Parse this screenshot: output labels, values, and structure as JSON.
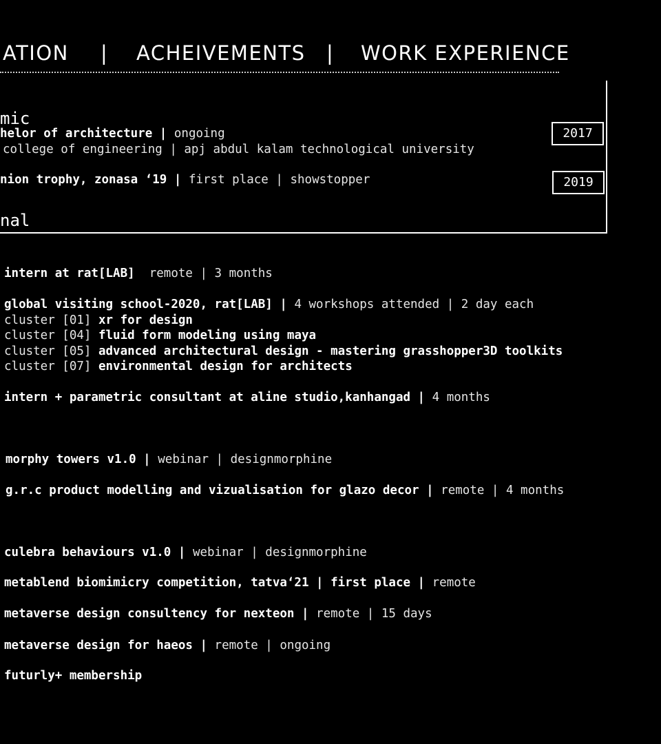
{
  "nav": {
    "education": "ATION",
    "sep1": "|",
    "achievements": "ACHEIVEMENTS",
    "sep2": "|",
    "work_experience": "WORK EXPERIENCE"
  },
  "panel": {
    "heading_academic": "mic",
    "degree_bold": "helor of architecture |",
    "degree_light": "ongoing",
    "college": "college of engineering | apj abdul kalam technological university",
    "year_1": "2017",
    "trophy_bold": "nion trophy, zonasa ‘19 |",
    "trophy_light": "first place | showstopper",
    "year_2": "2019",
    "heading_personal": "nal"
  },
  "entries": [
    {
      "bold": "intern at rat[LAB]",
      "light": "  remote | 3 months"
    },
    {
      "bold": "global visiting school-2020, rat[LAB] |",
      "light": " 4 workshops attended | 2 day each"
    },
    {
      "bold": "",
      "light": "cluster [01] ",
      "bold2": "xr for design"
    },
    {
      "bold": "",
      "light": "cluster [04] ",
      "bold2": "fluid form modeling using maya"
    },
    {
      "bold": "",
      "light": "cluster [05] ",
      "bold2": "advanced architectural design - mastering grasshopper3D toolkits"
    },
    {
      "bold": "",
      "light": "cluster [07] ",
      "bold2": "environmental design for architects"
    },
    {
      "bold": "intern + parametric consultant at aline studio,kanhangad |",
      "light": " 4 months"
    },
    {
      "bold": "morphy towers v1.0 |",
      "light": " webinar | designmorphine"
    },
    {
      "bold": "g.r.c product modelling and vizualisation for glazo decor |",
      "light": " remote | 4 months"
    },
    {
      "bold": "culebra behaviours v1.0 |",
      "light": " webinar | designmorphine"
    },
    {
      "bold": "metablend biomimicry competition, tatva‘21 | first place |",
      "light": " remote"
    },
    {
      "bold": "metaverse design consultency for nexteon |",
      "light": " remote | 15 days"
    },
    {
      "bold": "metaverse design for haeos |",
      "light": " remote | ongoing"
    },
    {
      "bold": "futurly+ membership",
      "light": ""
    }
  ]
}
